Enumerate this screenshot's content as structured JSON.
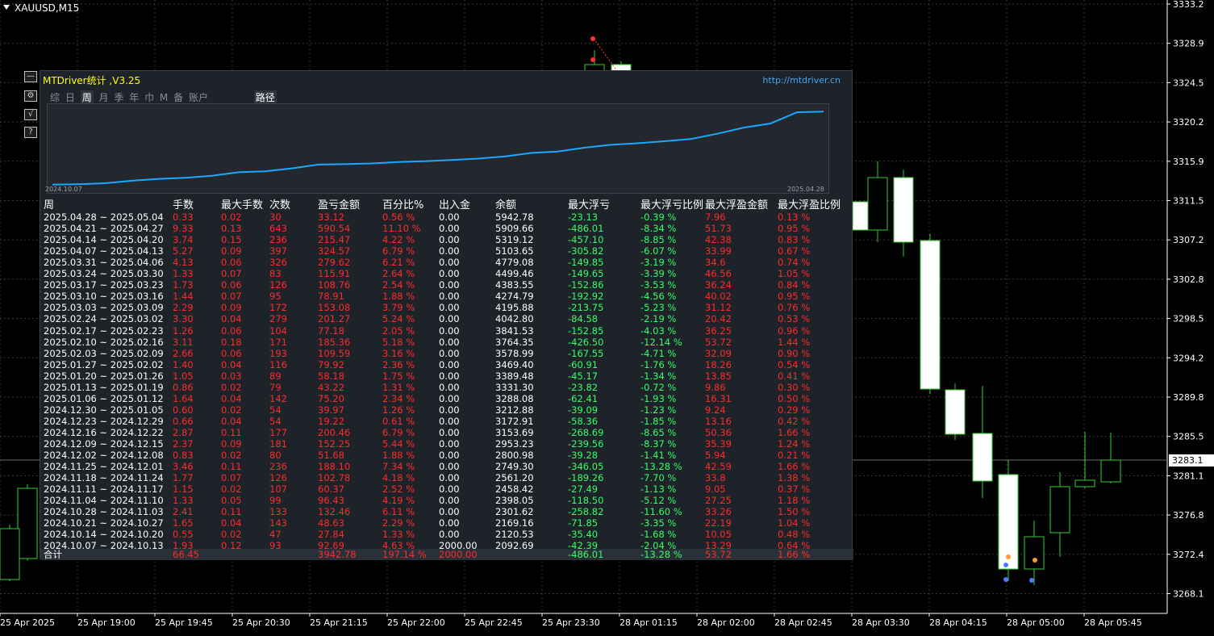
{
  "chart": {
    "symbol": "XAUUSD,M15",
    "current_price": "3283.1",
    "price_axis": [
      "3333.2",
      "3328.9",
      "3324.5",
      "3320.2",
      "3315.9",
      "3311.5",
      "3307.2",
      "3302.8",
      "3298.5",
      "3294.2",
      "3289.8",
      "3285.5",
      "3281.1",
      "3276.8",
      "3272.4",
      "3268.1"
    ],
    "time_axis": [
      "25 Apr 2025",
      "25 Apr 19:00",
      "25 Apr 19:45",
      "25 Apr 20:30",
      "25 Apr 21:15",
      "25 Apr 22:00",
      "25 Apr 22:45",
      "25 Apr 23:30",
      "28 Apr 01:15",
      "28 Apr 02:00",
      "28 Apr 02:45",
      "28 Apr 03:30",
      "28 Apr 04:15",
      "28 Apr 05:00",
      "28 Apr 05:45"
    ],
    "colors": {
      "background": "#000000",
      "bull": "#000000",
      "bear": "#ffffff",
      "candle_outline": "#33cc33",
      "grid": "#404040"
    }
  },
  "side_buttons": [
    {
      "name": "minimize-button",
      "glyph": "—"
    },
    {
      "name": "settings-button",
      "glyph": "⚙"
    },
    {
      "name": "chart-button",
      "glyph": "√"
    },
    {
      "name": "help-button",
      "glyph": "?"
    }
  ],
  "panel": {
    "title": "MTDriver统计 ,V3.25",
    "link": "http://mtdriver.cn",
    "tabs": [
      "综",
      "日",
      "周",
      "月",
      "季",
      "年",
      "巾",
      "M",
      "备",
      "账户"
    ],
    "active_tab": "周",
    "path_button": "路径",
    "equity_start_date": "2024.10.07",
    "equity_end_date": "2025.04.28",
    "headers": {
      "week": "周",
      "lots": "手数",
      "max_lots": "最大手数",
      "count": "次数",
      "pl": "盈亏金额",
      "pct": "百分比%",
      "io": "出入金",
      "balance": "余额",
      "max_dd": "最大浮亏",
      "max_dd_pct": "最大浮亏比例",
      "max_fp": "最大浮盈金额",
      "max_fp_pct": "最大浮盈比例"
    },
    "rows": [
      [
        "2025.04.28 ~ 2025.05.04",
        "0.33",
        "0.02",
        "30",
        "33.12",
        "0.56 %",
        "0.00",
        "5942.78",
        "-23.13",
        "-0.39 %",
        "7.96",
        "0.13 %"
      ],
      [
        "2025.04.21 ~ 2025.04.27",
        "9.33",
        "0.13",
        "643",
        "590.54",
        "11.10 %",
        "0.00",
        "5909.66",
        "-486.01",
        "-8.34 %",
        "51.73",
        "0.95 %"
      ],
      [
        "2025.04.14 ~ 2025.04.20",
        "3.74",
        "0.15",
        "236",
        "215.47",
        "4.22 %",
        "0.00",
        "5319.12",
        "-457.10",
        "-8.85 %",
        "42.38",
        "0.83 %"
      ],
      [
        "2025.04.07 ~ 2025.04.13",
        "5.27",
        "0.09",
        "397",
        "324.57",
        "6.79 %",
        "0.00",
        "5103.65",
        "-305.82",
        "-6.07 %",
        "33.99",
        "0.67 %"
      ],
      [
        "2025.03.31 ~ 2025.04.06",
        "4.13",
        "0.06",
        "326",
        "279.62",
        "6.21 %",
        "0.00",
        "4779.08",
        "-149.85",
        "-3.19 %",
        "34.6",
        "0.74 %"
      ],
      [
        "2025.03.24 ~ 2025.03.30",
        "1.33",
        "0.07",
        "83",
        "115.91",
        "2.64 %",
        "0.00",
        "4499.46",
        "-149.65",
        "-3.39 %",
        "46.56",
        "1.05 %"
      ],
      [
        "2025.03.17 ~ 2025.03.23",
        "1.73",
        "0.06",
        "126",
        "108.76",
        "2.54 %",
        "0.00",
        "4383.55",
        "-152.86",
        "-3.53 %",
        "36.24",
        "0.84 %"
      ],
      [
        "2025.03.10 ~ 2025.03.16",
        "1.44",
        "0.07",
        "95",
        "78.91",
        "1.88 %",
        "0.00",
        "4274.79",
        "-192.92",
        "-4.56 %",
        "40.02",
        "0.95 %"
      ],
      [
        "2025.03.03 ~ 2025.03.09",
        "2.29",
        "0.09",
        "172",
        "153.08",
        "3.79 %",
        "0.00",
        "4195.88",
        "-213.75",
        "-5.23 %",
        "31.12",
        "0.76 %"
      ],
      [
        "2025.02.24 ~ 2025.03.02",
        "3.30",
        "0.04",
        "279",
        "201.27",
        "5.24 %",
        "0.00",
        "4042.80",
        "-84.58",
        "-2.19 %",
        "20.42",
        "0.53 %"
      ],
      [
        "2025.02.17 ~ 2025.02.23",
        "1.26",
        "0.06",
        "104",
        "77.18",
        "2.05 %",
        "0.00",
        "3841.53",
        "-152.85",
        "-4.03 %",
        "36.25",
        "0.96 %"
      ],
      [
        "2025.02.10 ~ 2025.02.16",
        "3.11",
        "0.18",
        "171",
        "185.36",
        "5.18 %",
        "0.00",
        "3764.35",
        "-426.50",
        "-12.14 %",
        "53.72",
        "1.44 %"
      ],
      [
        "2025.02.03 ~ 2025.02.09",
        "2.66",
        "0.06",
        "193",
        "109.59",
        "3.16 %",
        "0.00",
        "3578.99",
        "-167.55",
        "-4.71 %",
        "32.09",
        "0.90 %"
      ],
      [
        "2025.01.27 ~ 2025.02.02",
        "1.40",
        "0.04",
        "116",
        "79.92",
        "2.36 %",
        "0.00",
        "3469.40",
        "-60.91",
        "-1.76 %",
        "18.26",
        "0.54 %"
      ],
      [
        "2025.01.20 ~ 2025.01.26",
        "1.05",
        "0.03",
        "89",
        "58.18",
        "1.75 %",
        "0.00",
        "3389.48",
        "-45.17",
        "-1.34 %",
        "13.85",
        "0.41 %"
      ],
      [
        "2025.01.13 ~ 2025.01.19",
        "0.86",
        "0.02",
        "79",
        "43.22",
        "1.31 %",
        "0.00",
        "3331.30",
        "-23.82",
        "-0.72 %",
        "9.86",
        "0.30 %"
      ],
      [
        "2025.01.06 ~ 2025.01.12",
        "1.64",
        "0.04",
        "142",
        "75.20",
        "2.34 %",
        "0.00",
        "3288.08",
        "-62.41",
        "-1.93 %",
        "16.31",
        "0.50 %"
      ],
      [
        "2024.12.30 ~ 2025.01.05",
        "0.60",
        "0.02",
        "54",
        "39.97",
        "1.26 %",
        "0.00",
        "3212.88",
        "-39.09",
        "-1.23 %",
        "9.24",
        "0.29 %"
      ],
      [
        "2024.12.23 ~ 2024.12.29",
        "0.66",
        "0.04",
        "54",
        "19.22",
        "0.61 %",
        "0.00",
        "3172.91",
        "-58.36",
        "-1.85 %",
        "13.16",
        "0.42 %"
      ],
      [
        "2024.12.16 ~ 2024.12.22",
        "2.87",
        "0.11",
        "177",
        "200.46",
        "6.79 %",
        "0.00",
        "3153.69",
        "-268.69",
        "-8.65 %",
        "50.36",
        "1.66 %"
      ],
      [
        "2024.12.09 ~ 2024.12.15",
        "2.37",
        "0.09",
        "181",
        "152.25",
        "5.44 %",
        "0.00",
        "2953.23",
        "-239.56",
        "-8.37 %",
        "35.39",
        "1.24 %"
      ],
      [
        "2024.12.02 ~ 2024.12.08",
        "0.83",
        "0.02",
        "80",
        "51.68",
        "1.88 %",
        "0.00",
        "2800.98",
        "-39.28",
        "-1.41 %",
        "5.94",
        "0.21 %"
      ],
      [
        "2024.11.25 ~ 2024.12.01",
        "3.46",
        "0.11",
        "236",
        "188.10",
        "7.34 %",
        "0.00",
        "2749.30",
        "-346.05",
        "-13.28 %",
        "42.59",
        "1.66 %"
      ],
      [
        "2024.11.18 ~ 2024.11.24",
        "1.77",
        "0.07",
        "126",
        "102.78",
        "4.18 %",
        "0.00",
        "2561.20",
        "-189.26",
        "-7.70 %",
        "33.8",
        "1.38 %"
      ],
      [
        "2024.11.11 ~ 2024.11.17",
        "1.15",
        "0.02",
        "107",
        "60.37",
        "2.52 %",
        "0.00",
        "2458.42",
        "-27.49",
        "-1.13 %",
        "9.05",
        "0.37 %"
      ],
      [
        "2024.11.04 ~ 2024.11.10",
        "1.33",
        "0.05",
        "99",
        "96.43",
        "4.19 %",
        "0.00",
        "2398.05",
        "-118.50",
        "-5.12 %",
        "27.25",
        "1.18 %"
      ],
      [
        "2024.10.28 ~ 2024.11.03",
        "2.41",
        "0.11",
        "133",
        "132.46",
        "6.11 %",
        "0.00",
        "2301.62",
        "-258.82",
        "-11.60 %",
        "33.26",
        "1.50 %"
      ],
      [
        "2024.10.21 ~ 2024.10.27",
        "1.65",
        "0.04",
        "143",
        "48.63",
        "2.29 %",
        "0.00",
        "2169.16",
        "-71.85",
        "-3.35 %",
        "22.19",
        "1.04 %"
      ],
      [
        "2024.10.14 ~ 2024.10.20",
        "0.55",
        "0.02",
        "47",
        "27.84",
        "1.33 %",
        "0.00",
        "2120.53",
        "-35.40",
        "-1.68 %",
        "10.05",
        "0.48 %"
      ],
      [
        "2024.10.07 ~ 2024.10.13",
        "1.93",
        "0.12",
        "93",
        "92.69",
        "4.63 %",
        "2000.00",
        "2092.69",
        "-42.39",
        "-2.04 %",
        "13.29",
        "0.64 %"
      ]
    ],
    "total": [
      "合计",
      "66.45",
      "",
      "",
      "3942.78",
      "197.14 %",
      "2000.00",
      "",
      "-486.01",
      "-13.28 %",
      "53.72",
      "1.66 %"
    ],
    "equity_curve": [
      2092.69,
      2120.53,
      2169.16,
      2301.62,
      2398.05,
      2458.42,
      2561.2,
      2749.3,
      2800.98,
      2953.23,
      3153.69,
      3172.91,
      3212.88,
      3288.08,
      3331.3,
      3389.48,
      3469.4,
      3578.99,
      3764.35,
      3841.53,
      4042.8,
      4195.88,
      4274.79,
      4383.55,
      4499.46,
      4779.08,
      5103.65,
      5319.12,
      5909.66,
      5942.78
    ]
  }
}
